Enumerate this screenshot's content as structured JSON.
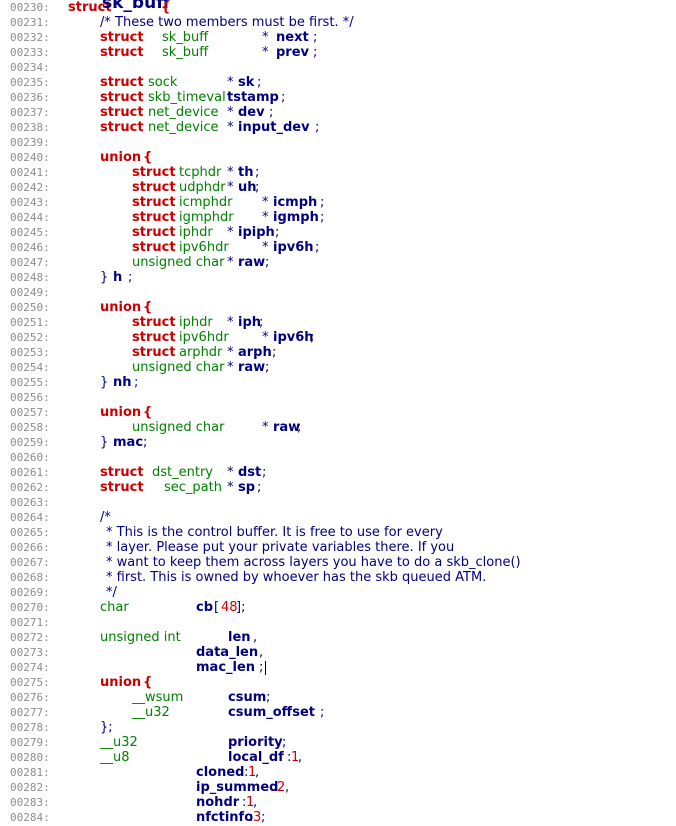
{
  "lines": [
    {
      "n": "00230:",
      "segs": [
        {
          "t": "struct",
          "c": "kw"
        },
        {
          "t": "sk_buff",
          "c": "id big"
        },
        {
          "t": "{",
          "c": "kw"
        }
      ]
    },
    {
      "n": "00231:",
      "segs": [
        {
          "t": "/* These two members must be first. */",
          "c": "cm"
        }
      ]
    },
    {
      "n": "00232:",
      "segs": [
        {
          "t": "struct",
          "c": "kw"
        },
        {
          "t": "sk_buff",
          "c": "ty"
        },
        {
          "t": "*",
          "c": "pn"
        },
        {
          "t": "next",
          "c": "id"
        },
        {
          "t": ";",
          "c": "pn"
        }
      ]
    },
    {
      "n": "00233:",
      "segs": [
        {
          "t": "struct",
          "c": "kw"
        },
        {
          "t": "sk_buff",
          "c": "ty"
        },
        {
          "t": "*",
          "c": "pn"
        },
        {
          "t": "prev",
          "c": "id"
        },
        {
          "t": ";",
          "c": "pn"
        }
      ]
    },
    {
      "n": "00234:",
      "segs": []
    },
    {
      "n": "00235:",
      "segs": [
        {
          "t": "struct",
          "c": "kw"
        },
        {
          "t": "sock",
          "c": "ty"
        },
        {
          "t": "*",
          "c": "pn"
        },
        {
          "t": "sk",
          "c": "id"
        },
        {
          "t": ";",
          "c": "pn"
        }
      ]
    },
    {
      "n": "00236:",
      "segs": [
        {
          "t": "struct",
          "c": "kw"
        },
        {
          "t": "skb_timeval",
          "c": "ty"
        },
        {
          "t": "tstamp",
          "c": "id"
        },
        {
          "t": ";",
          "c": "pn"
        }
      ]
    },
    {
      "n": "00237:",
      "segs": [
        {
          "t": "struct",
          "c": "kw"
        },
        {
          "t": "net_device",
          "c": "ty"
        },
        {
          "t": "*",
          "c": "pn"
        },
        {
          "t": "dev",
          "c": "id"
        },
        {
          "t": ";",
          "c": "pn"
        }
      ]
    },
    {
      "n": "00238:",
      "segs": [
        {
          "t": "struct",
          "c": "kw"
        },
        {
          "t": "net_device",
          "c": "ty"
        },
        {
          "t": "*",
          "c": "pn"
        },
        {
          "t": "input_dev",
          "c": "id"
        },
        {
          "t": ";",
          "c": "pn"
        }
      ]
    },
    {
      "n": "00239:",
      "segs": []
    },
    {
      "n": "00240:",
      "segs": [
        {
          "t": "union",
          "c": "kw"
        },
        {
          "t": "{",
          "c": "kw"
        }
      ]
    },
    {
      "n": "00241:",
      "segs": [
        {
          "t": "struct",
          "c": "kw"
        },
        {
          "t": "tcphdr",
          "c": "ty"
        },
        {
          "t": "*",
          "c": "pn"
        },
        {
          "t": "th",
          "c": "id"
        },
        {
          "t": ";",
          "c": "pn"
        }
      ]
    },
    {
      "n": "00242:",
      "segs": [
        {
          "t": "struct",
          "c": "kw"
        },
        {
          "t": "udphdr",
          "c": "ty"
        },
        {
          "t": "*",
          "c": "pn"
        },
        {
          "t": "uh",
          "c": "id"
        },
        {
          "t": ";",
          "c": "pn"
        }
      ]
    },
    {
      "n": "00243:",
      "segs": [
        {
          "t": "struct",
          "c": "kw"
        },
        {
          "t": "icmphdr",
          "c": "ty"
        },
        {
          "t": "*",
          "c": "pn"
        },
        {
          "t": "icmph",
          "c": "id"
        },
        {
          "t": ";",
          "c": "pn"
        }
      ]
    },
    {
      "n": "00244:",
      "segs": [
        {
          "t": "struct",
          "c": "kw"
        },
        {
          "t": "igmphdr",
          "c": "ty"
        },
        {
          "t": "*",
          "c": "pn"
        },
        {
          "t": "igmph",
          "c": "id"
        },
        {
          "t": ";",
          "c": "pn"
        }
      ]
    },
    {
      "n": "00245:",
      "segs": [
        {
          "t": "struct",
          "c": "kw"
        },
        {
          "t": "iphdr",
          "c": "ty"
        },
        {
          "t": "*",
          "c": "pn"
        },
        {
          "t": "ipiph",
          "c": "id"
        },
        {
          "t": ";",
          "c": "pn"
        }
      ]
    },
    {
      "n": "00246:",
      "segs": [
        {
          "t": "struct",
          "c": "kw"
        },
        {
          "t": "ipv6hdr",
          "c": "ty"
        },
        {
          "t": "*",
          "c": "pn"
        },
        {
          "t": "ipv6h",
          "c": "id"
        },
        {
          "t": ";",
          "c": "pn"
        }
      ]
    },
    {
      "n": "00247:",
      "segs": [
        {
          "t": "unsigned char",
          "c": "ty"
        },
        {
          "t": "*",
          "c": "pn"
        },
        {
          "t": "raw",
          "c": "id"
        },
        {
          "t": ";",
          "c": "pn"
        }
      ]
    },
    {
      "n": "00248:",
      "segs": [
        {
          "t": "}",
          "c": "pn"
        },
        {
          "t": "h",
          "c": "id"
        },
        {
          "t": ";",
          "c": "pn"
        }
      ]
    },
    {
      "n": "00249:",
      "segs": []
    },
    {
      "n": "00250:",
      "segs": [
        {
          "t": "union",
          "c": "kw"
        },
        {
          "t": "{",
          "c": "kw"
        }
      ]
    },
    {
      "n": "00251:",
      "segs": [
        {
          "t": "struct",
          "c": "kw"
        },
        {
          "t": "iphdr",
          "c": "ty"
        },
        {
          "t": "*",
          "c": "pn"
        },
        {
          "t": "iph",
          "c": "id"
        },
        {
          "t": ";",
          "c": "pn"
        }
      ]
    },
    {
      "n": "00252:",
      "segs": [
        {
          "t": "struct",
          "c": "kw"
        },
        {
          "t": "ipv6hdr",
          "c": "ty"
        },
        {
          "t": "*",
          "c": "pn"
        },
        {
          "t": "ipv6h",
          "c": "id"
        },
        {
          "t": ";",
          "c": "pn"
        }
      ]
    },
    {
      "n": "00253:",
      "segs": [
        {
          "t": "struct",
          "c": "kw"
        },
        {
          "t": "arphdr",
          "c": "ty"
        },
        {
          "t": "*",
          "c": "pn"
        },
        {
          "t": "arph",
          "c": "id"
        },
        {
          "t": ";",
          "c": "pn"
        }
      ]
    },
    {
      "n": "00254:",
      "segs": [
        {
          "t": "unsigned char",
          "c": "ty"
        },
        {
          "t": "*",
          "c": "pn"
        },
        {
          "t": "raw",
          "c": "id"
        },
        {
          "t": ";",
          "c": "pn"
        }
      ]
    },
    {
      "n": "00255:",
      "segs": [
        {
          "t": "}",
          "c": "pn"
        },
        {
          "t": "nh",
          "c": "id"
        },
        {
          "t": ";",
          "c": "pn"
        }
      ]
    },
    {
      "n": "00256:",
      "segs": []
    },
    {
      "n": "00257:",
      "segs": [
        {
          "t": "union",
          "c": "kw"
        },
        {
          "t": "{",
          "c": "kw"
        }
      ]
    },
    {
      "n": "00258:",
      "segs": [
        {
          "t": "unsigned char",
          "c": "ty"
        },
        {
          "t": "*",
          "c": "pn"
        },
        {
          "t": "raw",
          "c": "id"
        },
        {
          "t": ";",
          "c": "pn"
        }
      ]
    },
    {
      "n": "00259:",
      "segs": [
        {
          "t": "}",
          "c": "pn"
        },
        {
          "t": "mac",
          "c": "id"
        },
        {
          "t": ";",
          "c": "pn"
        }
      ]
    },
    {
      "n": "00260:",
      "segs": []
    },
    {
      "n": "00261:",
      "segs": [
        {
          "t": "struct",
          "c": "kw"
        },
        {
          "t": "dst_entry",
          "c": "ty"
        },
        {
          "t": "*",
          "c": "pn"
        },
        {
          "t": "dst",
          "c": "id"
        },
        {
          "t": ";",
          "c": "pn"
        }
      ]
    },
    {
      "n": "00262:",
      "segs": [
        {
          "t": "struct",
          "c": "kw"
        },
        {
          "t": "sec_path",
          "c": "ty"
        },
        {
          "t": "*",
          "c": "pn"
        },
        {
          "t": "sp",
          "c": "id"
        },
        {
          "t": ";",
          "c": "pn"
        }
      ]
    },
    {
      "n": "00263:",
      "segs": []
    },
    {
      "n": "00264:",
      "segs": [
        {
          "t": "/*",
          "c": "cm"
        }
      ]
    },
    {
      "n": "00265:",
      "segs": [
        {
          "t": "* This is the control buffer. It is free to use for every",
          "c": "cm"
        }
      ]
    },
    {
      "n": "00266:",
      "segs": [
        {
          "t": "* layer. Please put your private variables there. If you",
          "c": "cm"
        }
      ]
    },
    {
      "n": "00267:",
      "segs": [
        {
          "t": "* want to keep them across layers you have to do a skb_clone()",
          "c": "cm"
        }
      ]
    },
    {
      "n": "00268:",
      "segs": [
        {
          "t": "* first. This is owned by whoever has the skb queued ATM.",
          "c": "cm"
        }
      ]
    },
    {
      "n": "00269:",
      "segs": [
        {
          "t": "*/",
          "c": "cm"
        }
      ]
    },
    {
      "n": "00270:",
      "segs": [
        {
          "t": "char",
          "c": "ty"
        },
        {
          "t": "cb",
          "c": "id"
        },
        {
          "t": "[",
          "c": "pn"
        },
        {
          "t": "48",
          "c": "nm"
        },
        {
          "t": "];",
          "c": "pn"
        }
      ]
    },
    {
      "n": "00271:",
      "segs": []
    },
    {
      "n": "00272:",
      "segs": [
        {
          "t": "unsigned int",
          "c": "ty"
        },
        {
          "t": "len",
          "c": "id"
        },
        {
          "t": ",",
          "c": "pn"
        }
      ]
    },
    {
      "n": "00273:",
      "segs": [
        {
          "t": "data_len",
          "c": "id"
        },
        {
          "t": ",",
          "c": "pn"
        }
      ]
    },
    {
      "n": "00274:",
      "segs": [
        {
          "t": "mac_len",
          "c": "id"
        },
        {
          "t": ";",
          "c": "pn"
        }
      ]
    },
    {
      "n": "00275:",
      "segs": [
        {
          "t": "union",
          "c": "kw"
        },
        {
          "t": "{",
          "c": "kw"
        }
      ]
    },
    {
      "n": "00276:",
      "segs": [
        {
          "t": "__wsum",
          "c": "ty"
        },
        {
          "t": "csum",
          "c": "id"
        },
        {
          "t": ";",
          "c": "pn"
        }
      ]
    },
    {
      "n": "00277:",
      "segs": [
        {
          "t": "__u32",
          "c": "ty"
        },
        {
          "t": "csum_offset",
          "c": "id"
        },
        {
          "t": ";",
          "c": "pn"
        }
      ]
    },
    {
      "n": "00278:",
      "segs": [
        {
          "t": "};",
          "c": "pn"
        }
      ]
    },
    {
      "n": "00279:",
      "segs": [
        {
          "t": "__u32",
          "c": "ty"
        },
        {
          "t": "priority",
          "c": "id"
        },
        {
          "t": ";",
          "c": "pn"
        }
      ]
    },
    {
      "n": "00280:",
      "segs": [
        {
          "t": "__u8",
          "c": "ty"
        },
        {
          "t": "local_df",
          "c": "id"
        },
        {
          "t": ":",
          "c": "pn"
        },
        {
          "t": "1",
          "c": "nm"
        },
        {
          "t": ",",
          "c": "pn"
        }
      ]
    },
    {
      "n": "00281:",
      "segs": [
        {
          "t": "cloned",
          "c": "id"
        },
        {
          "t": ":",
          "c": "pn"
        },
        {
          "t": "1",
          "c": "nm"
        },
        {
          "t": ",",
          "c": "pn"
        }
      ]
    },
    {
      "n": "00282:",
      "segs": [
        {
          "t": "ip_summed",
          "c": "id"
        },
        {
          "t": ":",
          "c": "pn"
        },
        {
          "t": "2",
          "c": "nm"
        },
        {
          "t": ",",
          "c": "pn"
        }
      ]
    },
    {
      "n": "00283:",
      "segs": [
        {
          "t": "nohdr",
          "c": "id"
        },
        {
          "t": ":",
          "c": "pn"
        },
        {
          "t": "1",
          "c": "nm"
        },
        {
          "t": ",",
          "c": "pn"
        }
      ]
    },
    {
      "n": "00284:",
      "segs": [
        {
          "t": "nfctinfo",
          "c": "id"
        },
        {
          "t": ":",
          "c": "pn"
        },
        {
          "t": "3",
          "c": "nm"
        },
        {
          "t": ";",
          "c": "pn"
        }
      ]
    }
  ]
}
